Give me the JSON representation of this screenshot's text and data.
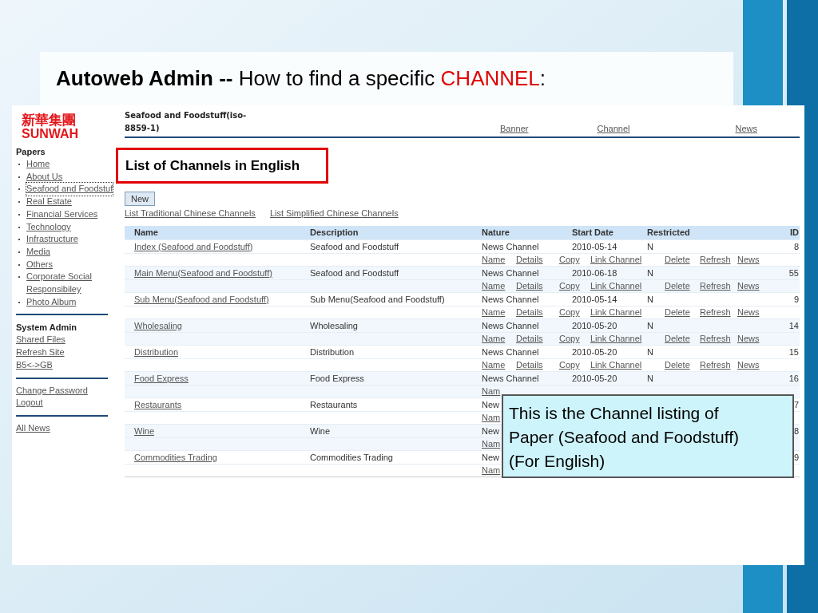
{
  "slide_title": {
    "bold": "Autoweb Admin --",
    "text": "How to find a specific",
    "highlight": "CHANNEL",
    "end": ":"
  },
  "sidebar": {
    "logo_cjk": "新華集團",
    "logo_latin": "SUNWAH",
    "sections": [
      {
        "heading": "Papers",
        "kind": "bulleted",
        "items": [
          {
            "label": "Home",
            "selected": false
          },
          {
            "label": "About Us",
            "selected": false
          },
          {
            "label": "Seafood and Foodstuf",
            "selected": true
          },
          {
            "label": "Real Estate",
            "selected": false
          },
          {
            "label": "Financial Services",
            "selected": false
          },
          {
            "label": "Technology",
            "selected": false
          },
          {
            "label": "Infrastructure",
            "selected": false
          },
          {
            "label": "Media",
            "selected": false
          },
          {
            "label": "Others",
            "selected": false
          },
          {
            "label": "Corporate Social Responsibiley",
            "selected": false
          },
          {
            "label": "Photo Album",
            "selected": false
          }
        ]
      },
      {
        "heading": "System Admin",
        "kind": "plain",
        "items": [
          {
            "label": "Shared Files",
            "selected": false
          },
          {
            "label": "Refresh Site",
            "selected": false
          },
          {
            "label": "B5<->GB",
            "selected": false
          }
        ]
      },
      {
        "kind": "plain",
        "items": [
          {
            "label": "Change Password",
            "selected": false
          },
          {
            "label": "Logout",
            "selected": false
          }
        ]
      },
      {
        "kind": "plain",
        "items": [
          {
            "label": "All News",
            "selected": false
          }
        ]
      }
    ]
  },
  "header": {
    "paper": "Seafood and Foodstuff(iso-8859-1)",
    "links": [
      "Banner",
      "Channel",
      "News"
    ]
  },
  "page_title": "List of Channels in English",
  "new_button": "New",
  "language_links": [
    "List Traditional Chinese Channels",
    "List Simplified Chinese Channels"
  ],
  "table": {
    "columns": [
      "Name",
      "Description",
      "Nature",
      "Start Date",
      "Restricted",
      "ID"
    ],
    "rows": [
      {
        "name": "Index (Seafood and Foodstuff)",
        "description": "Seafood and Foodstuff",
        "nature": "News Channel",
        "start_date": "2010-05-14",
        "restricted": "N",
        "id": "8",
        "actions": [
          "Name",
          "Details",
          "Copy",
          "Link Channel",
          "Delete",
          "Refresh",
          "News"
        ]
      },
      {
        "name": "Main Menu(Seafood and Foodstuff)",
        "description": "Seafood and Foodstuff",
        "nature": "News Channel",
        "start_date": "2010-06-18",
        "restricted": "N",
        "id": "55",
        "actions": [
          "Name",
          "Details",
          "Copy",
          "Link Channel",
          "Delete",
          "Refresh",
          "News"
        ]
      },
      {
        "name": "Sub Menu(Seafood and Foodstuff)",
        "description": "Sub Menu(Seafood and Foodstuff)",
        "nature": "News Channel",
        "start_date": "2010-05-14",
        "restricted": "N",
        "id": "9",
        "actions": [
          "Name",
          "Details",
          "Copy",
          "Link Channel",
          "Delete",
          "Refresh",
          "News"
        ]
      },
      {
        "name": "Wholesaling",
        "description": "Wholesaling",
        "nature": "News Channel",
        "start_date": "2010-05-20",
        "restricted": "N",
        "id": "14",
        "actions": [
          "Name",
          "Details",
          "Copy",
          "Link Channel",
          "Delete",
          "Refresh",
          "News"
        ]
      },
      {
        "name": "Distribution",
        "description": "Distribution",
        "nature": "News Channel",
        "start_date": "2010-05-20",
        "restricted": "N",
        "id": "15",
        "actions": [
          "Name",
          "Details",
          "Copy",
          "Link Channel",
          "Delete",
          "Refresh",
          "News"
        ]
      },
      {
        "name": "Food Express",
        "description": "Food Express",
        "nature": "News Channel",
        "start_date": "2010-05-20",
        "restricted": "N",
        "id": "16",
        "actions": [
          "Nam"
        ]
      },
      {
        "name": "Restaurants",
        "description": "Restaurants",
        "nature": "New",
        "id": "7",
        "actions": [
          "Nam"
        ]
      },
      {
        "name": "Wine",
        "description": "Wine",
        "nature": "New",
        "id": "8",
        "actions": [
          "Nam"
        ]
      },
      {
        "name": "Commodities Trading",
        "description": "Commodities Trading",
        "nature": "New",
        "id": "9",
        "actions": [
          "Nam"
        ]
      }
    ]
  },
  "callout_lines": [
    "This is the Channel listing of",
    "Paper (Seafood and Foodstuff)",
    "(For English)"
  ]
}
